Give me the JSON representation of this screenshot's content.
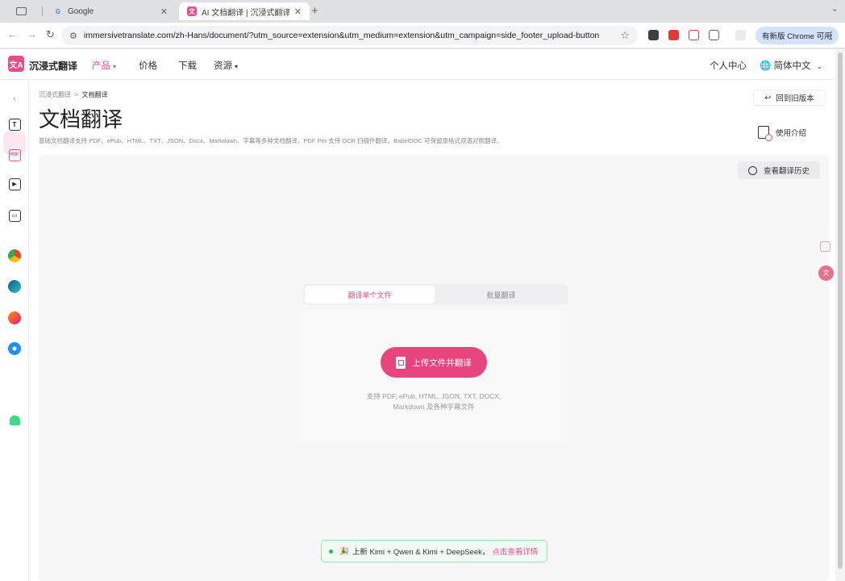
{
  "browser": {
    "tabs": [
      {
        "title": "",
        "icon": "sidebar-toggle-icon"
      },
      {
        "title": "Google",
        "icon": "google-icon"
      },
      {
        "title": "AI 文档翻译 | 沉浸式翻译：支",
        "icon": "immersive-translate-icon"
      }
    ],
    "url": "immersivetranslate.com/zh-Hans/document/?utm_source=extension&utm_medium=extension&utm_campaign=side_footer_upload-button",
    "update_label": "有新版 Chrome 可用",
    "colors": {
      "tabstrip": "#dfe1e5",
      "update_pill": "#d3e3fd"
    }
  },
  "header": {
    "brand": "沉浸式翻译",
    "nav": [
      "产品",
      "价格",
      "下载",
      "资源"
    ],
    "user_center": "个人中心",
    "language": "简体中文"
  },
  "sidebar": {
    "icons": [
      "text-icon",
      "pdf-icon",
      "video-icon",
      "image-icon",
      "chrome-icon",
      "edge-icon",
      "firefox-icon",
      "safari-icon",
      "apple-icon",
      "android-icon"
    ]
  },
  "main": {
    "breadcrumb": {
      "home": "沉浸式翻译",
      "separator": ">",
      "current": "文档翻译"
    },
    "title": "文档翻译",
    "subtitle": "基础文档翻译支持 PDF、ePub、HTML、TXT、JSON、Docx、Markdown、字幕等多种文档翻译。PDF Pro 支持 OCR 扫描件翻译。BabelDOC 可保留原格式双语对照翻译。",
    "old_version": "回到旧版本",
    "guide": "使用介绍",
    "history": "查看翻译历史",
    "mode_tabs": [
      "翻译单个文件",
      "批量翻译"
    ],
    "upload_button": "上传文件并翻译",
    "formats_line1": "支持 PDF, ePub, HTML, JSON, TXT, DOCX,",
    "formats_line2": "Markdown 及各种字幕文件"
  },
  "banner": {
    "text": "上新 Kimi + Qwen & Kimi + DeepSeek，",
    "link": "点击查看详情"
  },
  "accent_color": "#ea4c89"
}
